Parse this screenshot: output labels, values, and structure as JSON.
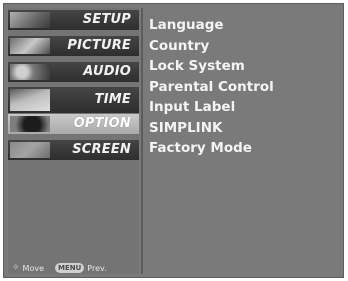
{
  "menu": {
    "items": [
      {
        "label": "SETUP",
        "icon": "setup-thumbnail-icon"
      },
      {
        "label": "PICTURE",
        "icon": "picture-thumbnail-icon"
      },
      {
        "label": "AUDIO",
        "icon": "audio-thumbnail-icon"
      },
      {
        "label": "TIME",
        "icon": "time-thumbnail-icon"
      },
      {
        "label": "OPTION",
        "icon": "option-thumbnail-icon"
      },
      {
        "label": "SCREEN",
        "icon": "screen-thumbnail-icon"
      }
    ],
    "selected": "OPTION"
  },
  "submenu": {
    "items": [
      "Language",
      "Country",
      "Lock System",
      "Parental Control",
      "Input Label",
      "SIMPLINK",
      "Factory Mode"
    ]
  },
  "footer": {
    "move_label": "Move",
    "menu_key": "MENU",
    "prev_label": "Prev."
  },
  "colors": {
    "panel_bg": "#7a7a7a",
    "menu_item_bg": "#3a3a3a",
    "menu_item_selected_bg": "#bbbbbb",
    "text": "#f4f4f4"
  }
}
